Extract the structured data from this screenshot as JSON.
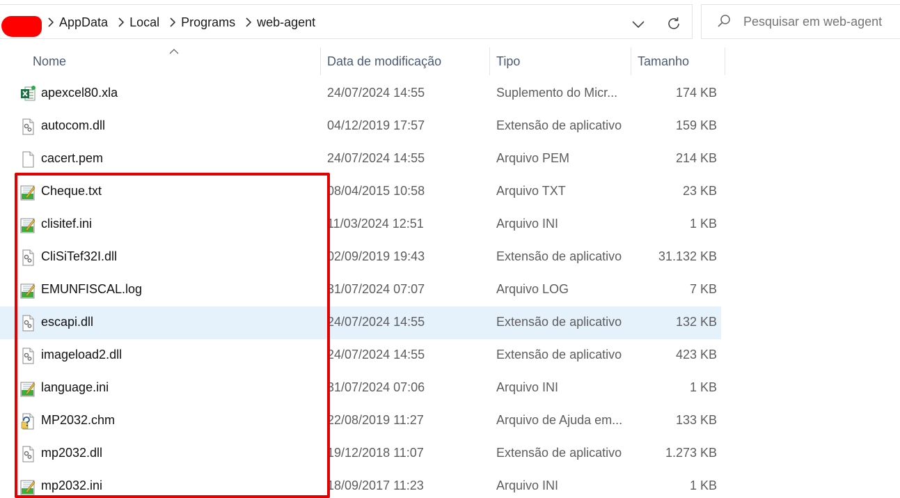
{
  "address_bar": {
    "breadcrumbs": [
      "AppData",
      "Local",
      "Programs",
      "web-agent"
    ]
  },
  "search": {
    "placeholder": "Pesquisar em web-agent"
  },
  "columns": {
    "name": "Nome",
    "date": "Data de modificação",
    "type": "Tipo",
    "size": "Tamanho"
  },
  "files": [
    {
      "name": "apexcel80.xla",
      "date": "24/07/2024 14:55",
      "type": "Suplemento do Micr...",
      "size": "174 KB",
      "icon": "excel-file-icon"
    },
    {
      "name": "autocom.dll",
      "date": "04/12/2019 17:57",
      "type": "Extensão de aplicativo",
      "size": "159 KB",
      "icon": "dll-file-icon"
    },
    {
      "name": "cacert.pem",
      "date": "24/07/2024 14:55",
      "type": "Arquivo PEM",
      "size": "214 KB",
      "icon": "blank-file-icon"
    },
    {
      "name": "Cheque.txt",
      "date": "08/04/2015 10:58",
      "type": "Arquivo TXT",
      "size": "23 KB",
      "icon": "notepad-file-icon"
    },
    {
      "name": "clisitef.ini",
      "date": "11/03/2024 12:51",
      "type": "Arquivo INI",
      "size": "1 KB",
      "icon": "notepad-file-icon"
    },
    {
      "name": "CliSiTef32I.dll",
      "date": "02/09/2019 19:43",
      "type": "Extensão de aplicativo",
      "size": "31.132 KB",
      "icon": "dll-file-icon"
    },
    {
      "name": "EMUNFISCAL.log",
      "date": "31/07/2024 07:07",
      "type": "Arquivo LOG",
      "size": "7 KB",
      "icon": "notepad-file-icon"
    },
    {
      "name": "escapi.dll",
      "date": "24/07/2024 14:55",
      "type": "Extensão de aplicativo",
      "size": "132 KB",
      "icon": "dll-file-icon",
      "selected": true
    },
    {
      "name": "imageload2.dll",
      "date": "24/07/2024 14:55",
      "type": "Extensão de aplicativo",
      "size": "423 KB",
      "icon": "dll-file-icon"
    },
    {
      "name": "language.ini",
      "date": "31/07/2024 07:06",
      "type": "Arquivo INI",
      "size": "1 KB",
      "icon": "notepad-file-icon"
    },
    {
      "name": "MP2032.chm",
      "date": "22/08/2019 11:27",
      "type": "Arquivo de Ajuda em...",
      "size": "133 KB",
      "icon": "help-file-icon"
    },
    {
      "name": "mp2032.dll",
      "date": "19/12/2018 11:07",
      "type": "Extensão de aplicativo",
      "size": "1.273 KB",
      "icon": "dll-file-icon"
    },
    {
      "name": "mp2032.ini",
      "date": "18/09/2017 11:23",
      "type": "Arquivo INI",
      "size": "1 KB",
      "icon": "notepad-file-icon"
    }
  ],
  "colors": {
    "selected_row": "#e5f1fb",
    "highlight_box": "#e50000",
    "redaction": "#ff0000"
  }
}
